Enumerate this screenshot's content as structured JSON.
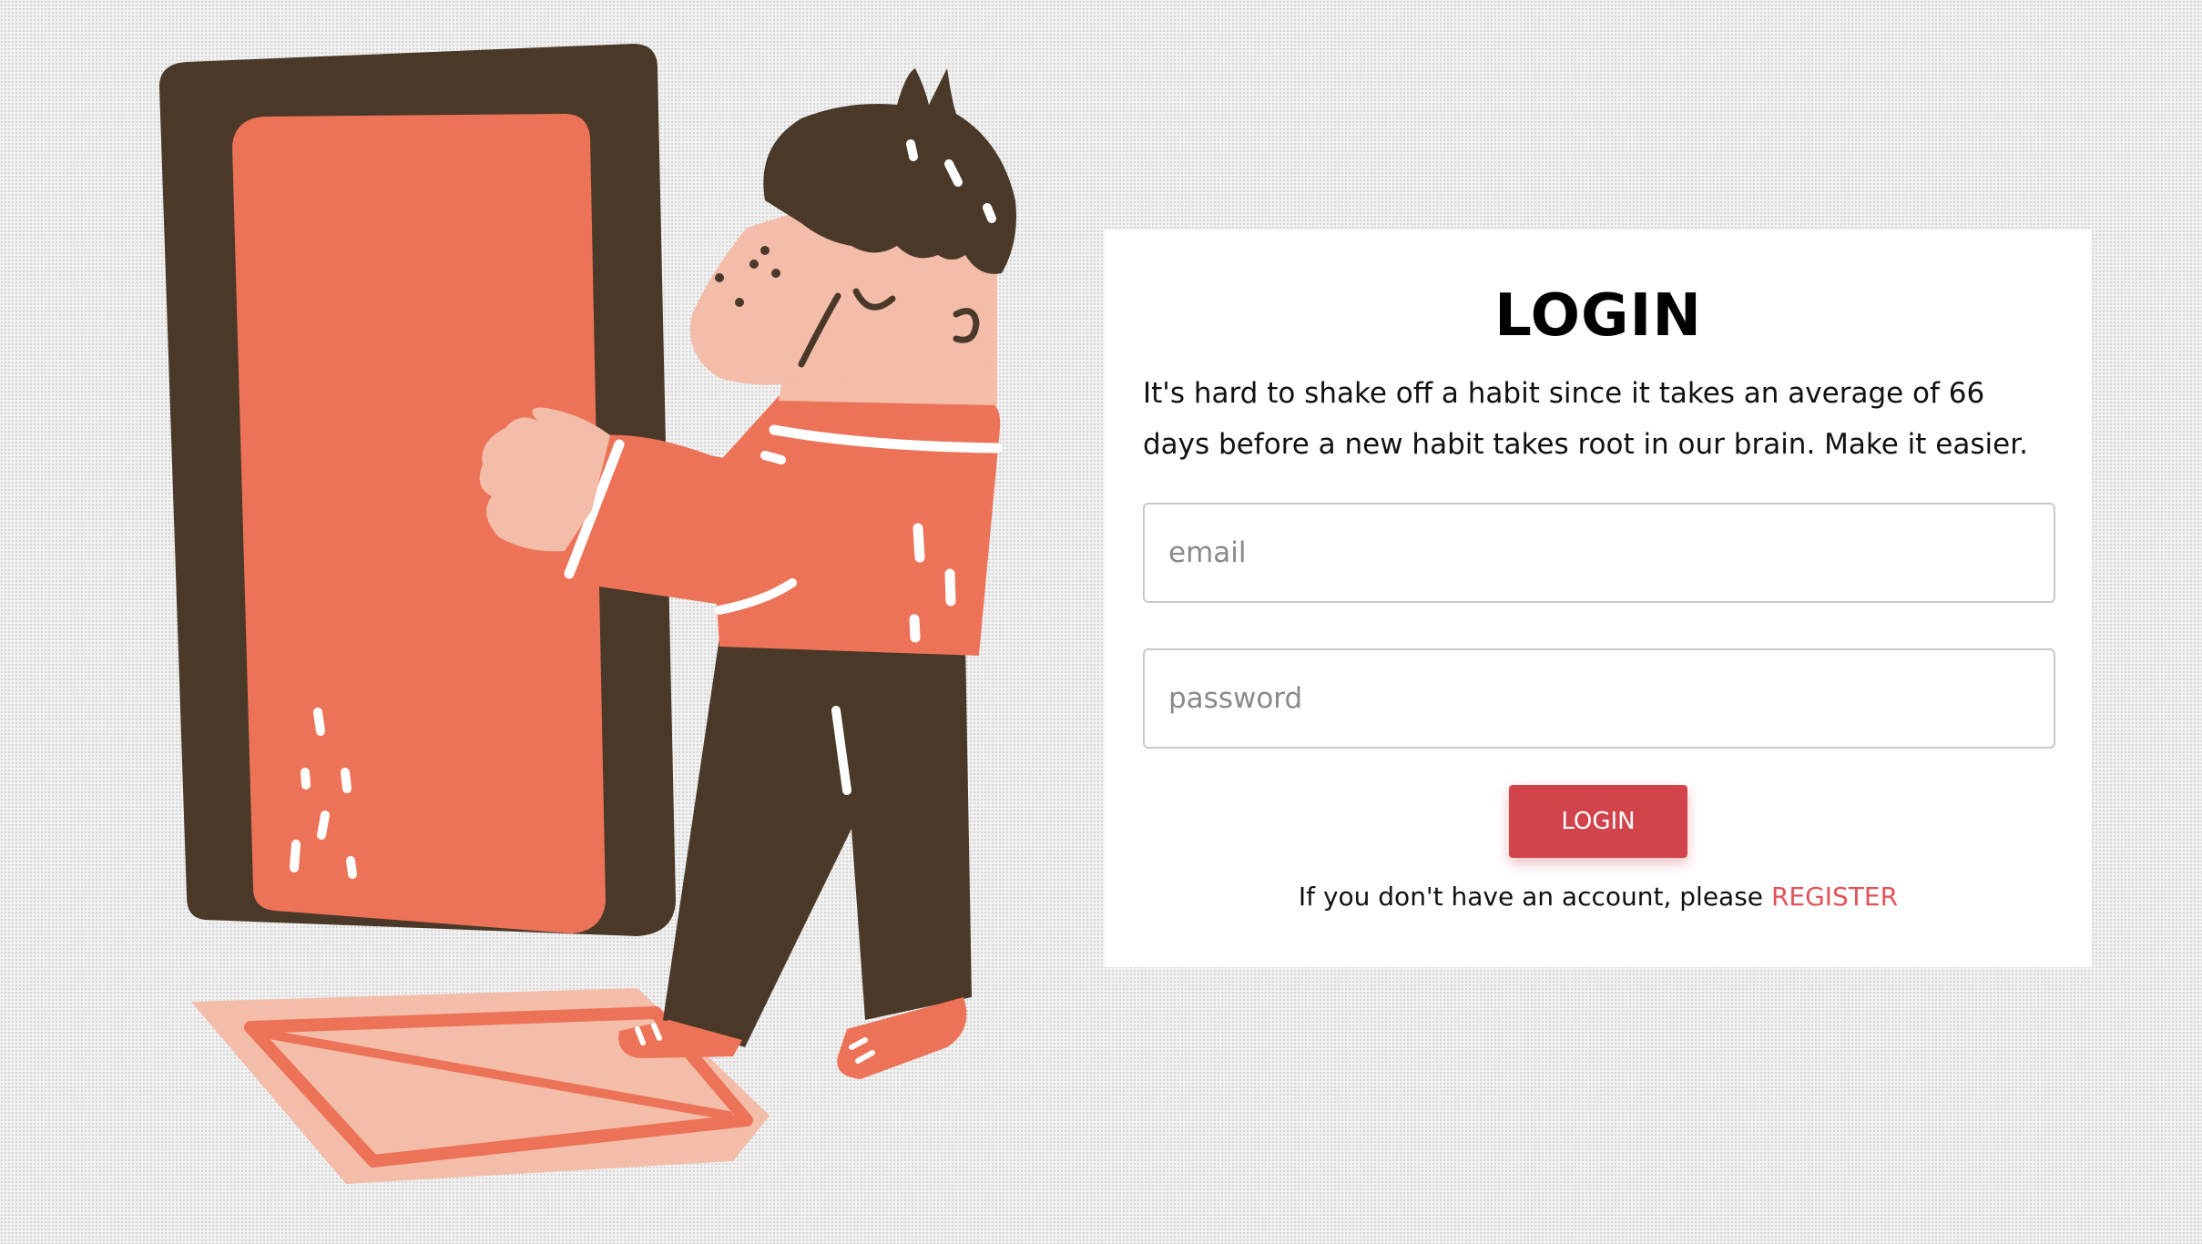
{
  "login": {
    "title": "LOGIN",
    "description": "It's hard to shake off a habit since it takes an average of 66 days before a new habit takes root in our brain. Make it easier.",
    "email_placeholder": "email",
    "password_placeholder": "password",
    "button_label": "LOGIN",
    "register_prompt": "If you don't have an account, please",
    "register_link": "REGISTER"
  },
  "illustration": {
    "icon": "person-opening-door-illustration"
  },
  "colors": {
    "accent": "#d2444b",
    "link": "#e2525a",
    "door": "#ec7358",
    "door_frame": "#4a3828",
    "skin": "#f3bda9",
    "card_background": "#ffffff"
  }
}
